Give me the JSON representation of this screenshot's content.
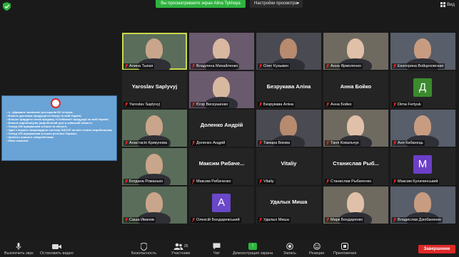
{
  "header": {
    "share_banner": "Вы просматриваете экран Alina Tykhaya",
    "view_settings": "Настройки просмотра",
    "view_label": "Вид"
  },
  "shared_screen": {
    "items": [
      "• 4 - фіраване зовнішніх ресторанів ЕК історію;",
      "• Власне доставка продукції по Києву та всій Україні;",
      "• Більше тридцяти точок продажу «Стейкової» продукції по всій Україні;",
      "• Власне виробництво (виробничий цех) в київській області;",
      "• Понад 150 працівників в Києві та області;",
      "• Одні з перших запровадили систему HACCP на всіх етапах виробництва;",
      "• Понад 150 працівників в інших регіонах України;",
      "• Цінність кожного співробітника;",
      "• Місія компанії."
    ]
  },
  "tiles": [
    {
      "label": "Алина Тыхая",
      "big": "",
      "kind": "video",
      "active": true
    },
    {
      "label": "Владлена Михайленко",
      "big": "",
      "kind": "video"
    },
    {
      "label": "Олег Кузьмин",
      "big": "",
      "kind": "video"
    },
    {
      "label": "Анна Ярмоленко",
      "big": "",
      "kind": "video"
    },
    {
      "label": "Екатерина Войцеховская",
      "big": "",
      "kind": "video"
    },
    {
      "label": "Yaroslav Saplyvyj",
      "big": "Yaroslav Saplyvyj",
      "kind": "name"
    },
    {
      "label": "Єгор Вискушенко",
      "big": "",
      "kind": "video"
    },
    {
      "label": "Безрукава Аліна",
      "big": "Безрукава Аліна",
      "kind": "name"
    },
    {
      "label": "Анна Бойко",
      "big": "Анна Бойко",
      "kind": "name"
    },
    {
      "label": "Dima Fertyuk",
      "big": "",
      "kind": "avatar",
      "letter": "Д",
      "color": "#3b8a2e"
    },
    {
      "label": "Анастасія Крикунова",
      "big": "",
      "kind": "video"
    },
    {
      "label": "Доленко Андрій",
      "big": "Доленко Андрій",
      "kind": "name"
    },
    {
      "label": "Тамара Бікова",
      "big": "",
      "kind": "video"
    },
    {
      "label": "Таня Ковальчук",
      "big": "",
      "kind": "video"
    },
    {
      "label": "Аня Кабанець",
      "big": "",
      "kind": "video"
    },
    {
      "label": "Богдана Романько",
      "big": "",
      "kind": "video"
    },
    {
      "label": "Максим Рибаченко",
      "big": "Максим Рибаче...",
      "kind": "name"
    },
    {
      "label": "Vitaliy",
      "big": "Vitaliy",
      "kind": "name"
    },
    {
      "label": "Станислав Рыбаченко",
      "big": "Станислав Рыб...",
      "kind": "name"
    },
    {
      "label": "Максим Кулачинський",
      "big": "",
      "kind": "avatar",
      "letter": "М",
      "color": "#6c3fc7"
    },
    {
      "label": "Саша Иванов",
      "big": "",
      "kind": "video"
    },
    {
      "label": "Олексій Бондаревський",
      "big": "",
      "kind": "avatar",
      "letter": "А",
      "color": "#6a48c9"
    },
    {
      "label": "Удалых Миша",
      "big": "Удалых Миша",
      "kind": "name"
    },
    {
      "label": "Марк Бондаренко",
      "big": "",
      "kind": "video"
    },
    {
      "label": "Владислав Дзюбаненко",
      "big": "",
      "kind": "video"
    }
  ],
  "toolbar": {
    "mute": "Выключить звук",
    "video": "Остановить видео",
    "security": "Безопасность",
    "participants": "Участники",
    "participants_count": "25",
    "chat": "Чат",
    "share": "Демонстрация экрана",
    "record": "Запись",
    "reactions": "Реакции",
    "apps": "Приложения",
    "end": "Завершение"
  },
  "colors": {
    "accent_green": "#2eb33f",
    "end_red": "#e02828",
    "active_outline": "#c9d94c"
  }
}
